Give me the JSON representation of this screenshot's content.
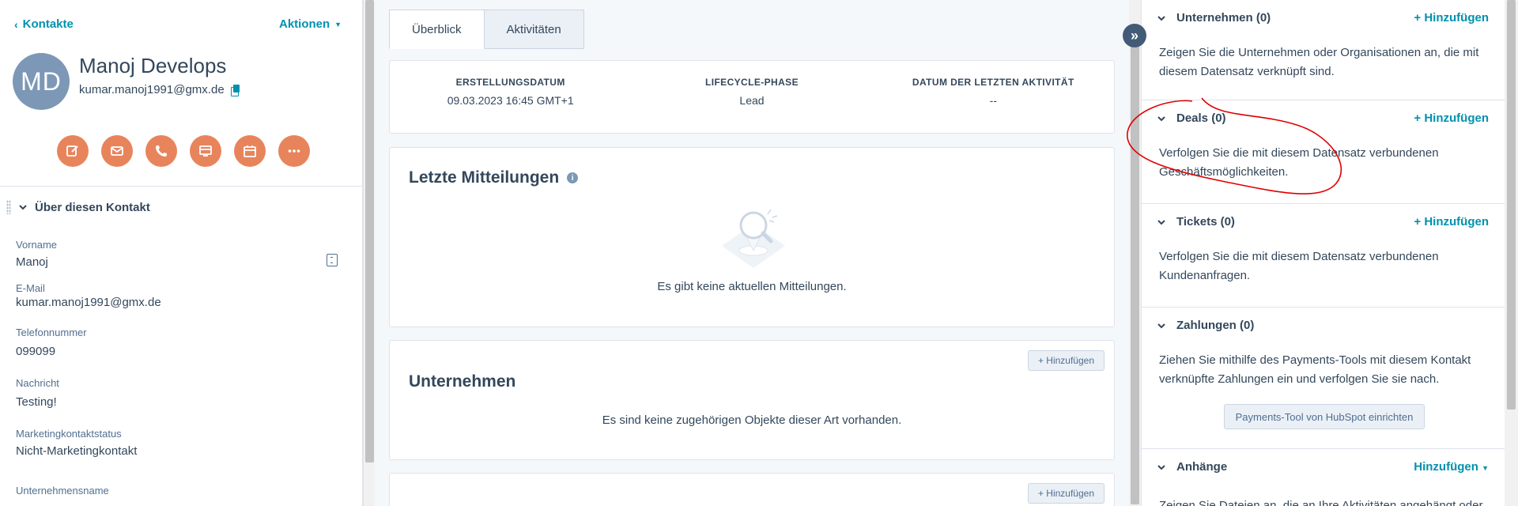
{
  "left": {
    "back_label": "Kontakte",
    "actions_label": "Aktionen",
    "avatar_initials": "MD",
    "name": "Manoj Develops",
    "email": "kumar.manoj1991@gmx.de",
    "action_icons": [
      "note-icon",
      "email-icon",
      "phone-icon",
      "meeting-icon",
      "calendar-icon",
      "more-icon"
    ],
    "section_title": "Über diesen Kontakt",
    "properties": [
      {
        "label": "Vorname",
        "value": "Manoj"
      },
      {
        "label": "E-Mail",
        "value": "kumar.manoj1991@gmx.de"
      },
      {
        "label": "Telefonnummer",
        "value": "099099"
      },
      {
        "label": "Nachricht",
        "value": "Testing!"
      },
      {
        "label": "Marketingkontaktstatus",
        "value": "Nicht-Marketingkontakt"
      },
      {
        "label": "Unternehmensname",
        "value": ""
      }
    ]
  },
  "tabs": [
    {
      "label": "Überblick",
      "active": true
    },
    {
      "label": "Aktivitäten",
      "active": false
    }
  ],
  "stats": [
    {
      "label": "ERSTELLUNGSDATUM",
      "value": "09.03.2023 16:45 GMT+1"
    },
    {
      "label": "LIFECYCLE-PHASE",
      "value": "Lead"
    },
    {
      "label": "DATUM DER LETZTEN AKTIVITÄT",
      "value": "--"
    }
  ],
  "recent": {
    "title": "Letzte Mitteilungen",
    "empty": "Es gibt keine aktuellen Mitteilungen."
  },
  "companies_card": {
    "title": "Unternehmen",
    "add_label": "+ Hinzufügen",
    "empty": "Es sind keine zugehörigen Objekte dieser Art vorhanden."
  },
  "next_card": {
    "add_label": "+ Hinzufügen"
  },
  "right": {
    "sections": [
      {
        "title": "Unternehmen (0)",
        "add": "+ Hinzufügen",
        "body": "Zeigen Sie die Unternehmen oder Organisationen an, die mit diesem Datensatz verknüpft sind."
      },
      {
        "title": "Deals (0)",
        "add": "+ Hinzufügen",
        "body": "Verfolgen Sie die mit diesem Datensatz verbundenen Geschäftsmöglichkeiten."
      },
      {
        "title": "Tickets (0)",
        "add": "+ Hinzufügen",
        "body": "Verfolgen Sie die mit diesem Datensatz verbundenen Kundenanfragen."
      },
      {
        "title": "Zahlungen (0)",
        "add": "",
        "body": "Ziehen Sie mithilfe des Payments-Tools mit diesem Kontakt verknüpfte Zahlungen ein und verfolgen Sie sie nach."
      },
      {
        "title": "Anhänge",
        "add": "Hinzufügen",
        "body": "Zeigen Sie Dateien an, die an Ihre Aktivitäten angehängt oder"
      }
    ],
    "payments_button": "Payments-Tool von HubSpot einrichten"
  },
  "colors": {
    "accent": "#0091ae",
    "action_button": "#e8845c",
    "avatar": "#7c98b6",
    "annotation": "#e00000"
  }
}
